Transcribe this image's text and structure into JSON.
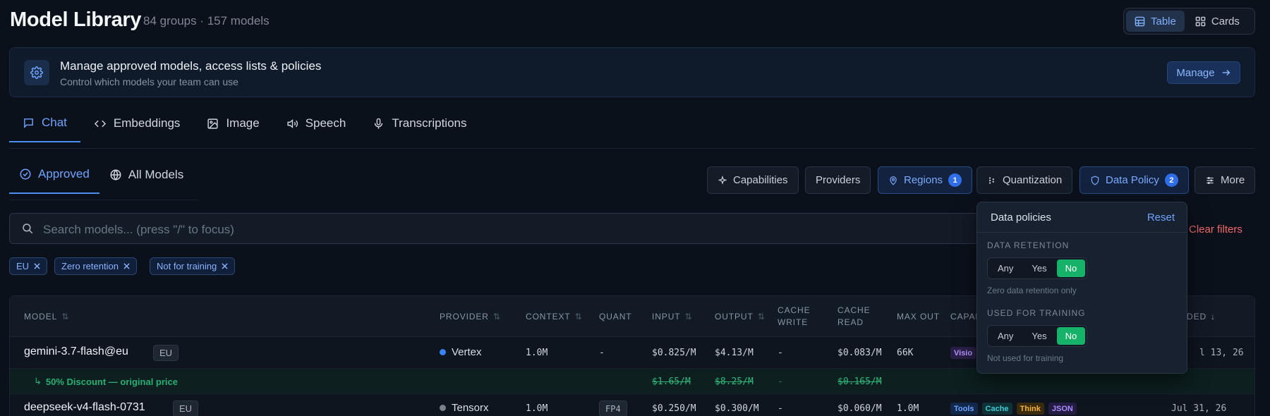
{
  "header": {
    "title": "Model Library",
    "subtitle": "84 groups · 157 models",
    "view_toggle": {
      "table": "Table",
      "cards": "Cards",
      "active": "Table"
    }
  },
  "banner": {
    "icon": "settings-gear-icon",
    "title": "Manage approved models, access lists & policies",
    "subtitle": "Control which models your team can use",
    "button": "Manage"
  },
  "tabs": [
    {
      "label": "Chat",
      "icon": "chat-bubble-icon",
      "active": true
    },
    {
      "label": "Embeddings",
      "icon": "code-brackets-icon"
    },
    {
      "label": "Image",
      "icon": "image-icon"
    },
    {
      "label": "Speech",
      "icon": "speaker-icon"
    },
    {
      "label": "Transcriptions",
      "icon": "microphone-icon"
    }
  ],
  "subtabs": [
    {
      "label": "Approved",
      "icon": "check-circle-icon",
      "active": true
    },
    {
      "label": "All Models",
      "icon": "globe-icon"
    }
  ],
  "filters": {
    "capabilities": "Capabilities",
    "providers": "Providers",
    "regions": "Regions",
    "regions_count": "1",
    "quantization": "Quantization",
    "data_policy": "Data Policy",
    "data_policy_count": "2",
    "more": "More"
  },
  "search": {
    "placeholder": "Search models... (press \"/\" to focus)"
  },
  "clear_filters": "Clear filters",
  "chips": [
    "EU",
    "Zero retention",
    "Not for training"
  ],
  "table": {
    "columns": {
      "model": "Model",
      "provider": "Provider",
      "context": "Context",
      "quant": "Quant",
      "input": "Input",
      "output": "Output",
      "cache_write": "Cache write",
      "cache_read": "Cache read",
      "max_out": "Max out",
      "capabilities": "Capab",
      "added": "ded"
    },
    "rows": [
      {
        "model": "gemini-3.7-flash@eu",
        "region": "EU",
        "provider": "Vertex",
        "provider_color": "#3b82f6",
        "context": "1.0M",
        "quant": "-",
        "input": "$0.825/M",
        "output": "$4.13/M",
        "cache_write": "-",
        "cache_read": "$0.083/M",
        "max_out": "66K",
        "caps": [
          "Visio"
        ],
        "added": "l 13, 26"
      },
      {
        "model": "deepseek-v4-flash-0731",
        "region": "EU",
        "provider": "Tensorx",
        "provider_color": "#7a828e",
        "context": "1.0M",
        "quant": "FP4",
        "input": "$0.250/M",
        "output": "$0.300/M",
        "cache_write": "-",
        "cache_read": "$0.060/M",
        "max_out": "1.0M",
        "caps": [
          "Tools",
          "Cache",
          "Think",
          "JSON"
        ],
        "added": "Jul 31, 26"
      }
    ],
    "discount": {
      "label": "50% Discount — original price",
      "input": "$1.65/M",
      "output": "$8.25/M",
      "cache_write": "-",
      "cache_read": "$0.165/M"
    }
  },
  "popover": {
    "title": "Data policies",
    "reset": "Reset",
    "retention": {
      "label": "DATA RETENTION",
      "options": [
        "Any",
        "Yes",
        "No"
      ],
      "selected": "No",
      "help": "Zero data retention only"
    },
    "training": {
      "label": "USED FOR TRAINING",
      "options": [
        "Any",
        "Yes",
        "No"
      ],
      "selected": "No",
      "help": "Not used for training"
    }
  },
  "colors": {
    "accent": "#4d8ef6",
    "selected_green": "#17b26a",
    "danger": "#f06a6a"
  }
}
